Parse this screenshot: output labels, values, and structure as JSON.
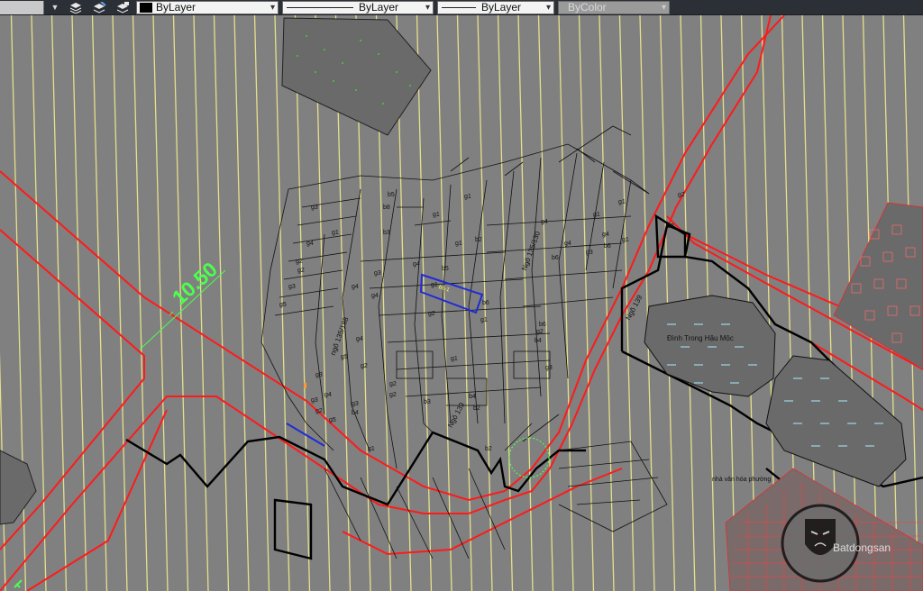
{
  "toolbar": {
    "color_value": "ByLayer",
    "linetype_value": "ByLayer",
    "lineweight_value": "ByLayer",
    "plotstyle_value": "ByColor"
  },
  "map": {
    "dimension": "10.50",
    "lot_marker": "b6-1",
    "roads": {
      "ngo_135_188": "ngõ 135/188",
      "ngo_135_130": "Ngõ 135/130",
      "ngo_139_left": "Ngõ 139",
      "ngo_139_right": "Ngõ 139"
    },
    "places": {
      "pond": "Đình Trong Hậu Mộc",
      "house_caption": "nhà văn hóa phường"
    },
    "lot_labels": [
      "b5",
      "b8",
      "b3",
      "g1",
      "g1",
      "g4",
      "g3",
      "g3",
      "g2",
      "g2",
      "g5",
      "g4",
      "g4",
      "g3",
      "g4",
      "g5",
      "g2",
      "g3",
      "g5",
      "g4",
      "g2",
      "g3",
      "g3",
      "b4",
      "g1",
      "g2",
      "g2",
      "b3",
      "g1",
      "g4",
      "b5",
      "g1",
      "g2",
      "g1",
      "b2",
      "b6",
      "g1",
      "g2",
      "g1",
      "b2",
      "g4",
      "b6",
      "g4",
      "g3",
      "b6",
      "g4",
      "g1",
      "g1",
      "g1",
      "b4",
      "b4",
      "g3",
      "b6",
      "b3",
      "g2",
      "b2"
    ],
    "watermark": "Batdongsan"
  },
  "colors": {
    "background": "#808080",
    "boundary_red": "#ff1a1a",
    "grid_yellow": "#e6e08a",
    "highlight_blue": "#1f2bd6",
    "dimension_green": "#4cff4c"
  }
}
